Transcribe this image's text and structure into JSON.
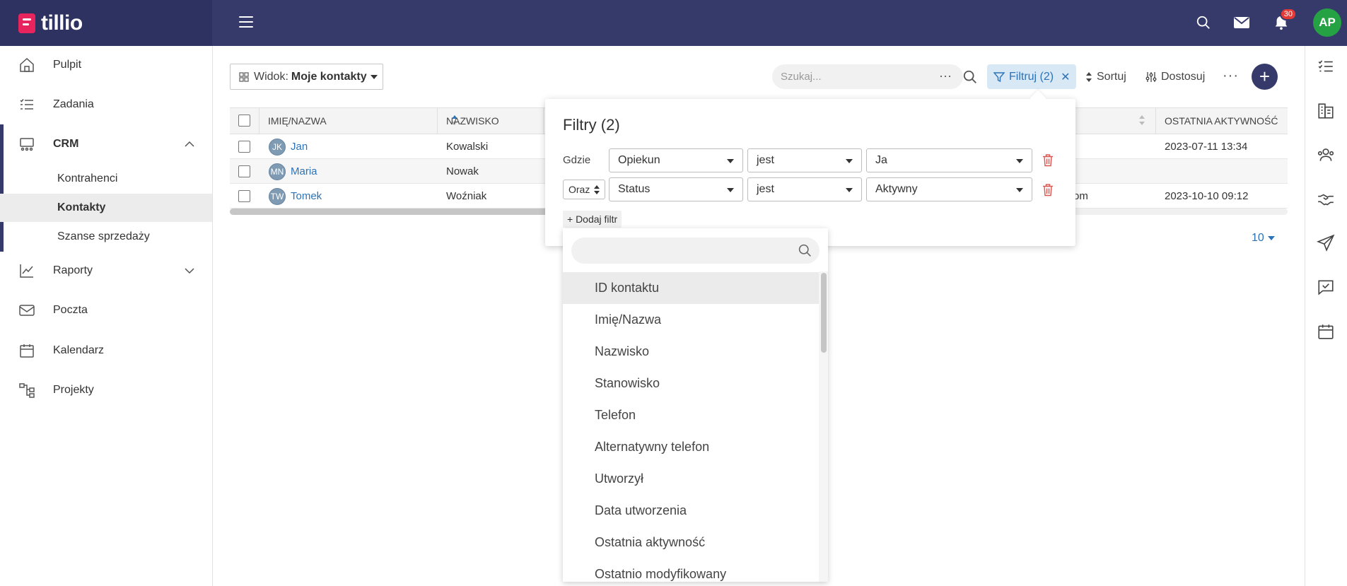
{
  "app": {
    "name": "tillio"
  },
  "topbar": {
    "notifications_count": "30",
    "user_initials": "AP"
  },
  "sidebar": {
    "items": [
      {
        "label": "Pulpit"
      },
      {
        "label": "Zadania"
      },
      {
        "label": "CRM"
      },
      {
        "label": "Raporty"
      },
      {
        "label": "Poczta"
      },
      {
        "label": "Kalendarz"
      },
      {
        "label": "Projekty"
      }
    ],
    "crm_sub": [
      {
        "label": "Kontrahenci"
      },
      {
        "label": "Kontakty"
      },
      {
        "label": "Szanse sprzedaży"
      }
    ]
  },
  "toolbar": {
    "view_prefix": "Widok:",
    "view_name": "Moje kontakty",
    "search_placeholder": "Szukaj...",
    "filter_label": "Filtruj (2)",
    "sort_label": "Sortuj",
    "customize_label": "Dostosuj"
  },
  "table": {
    "columns": [
      "IMIĘ/NAZWA",
      "NAZWISKO",
      "OSTATNIA AKTYWNOŚĆ"
    ],
    "rows": [
      {
        "initials": "JK",
        "first": "Jan",
        "last": "Kowalski",
        "email_tail": "",
        "activity": "2023-07-11 13:34"
      },
      {
        "initials": "MN",
        "first": "Maria",
        "last": "Nowak",
        "email_tail": "",
        "activity": ""
      },
      {
        "initials": "TW",
        "first": "Tomek",
        "last": "Woźniak",
        "email_tail": "om",
        "activity": "2023-10-10 09:12"
      }
    ],
    "page_size": "10"
  },
  "filters": {
    "title": "Filtry (2)",
    "where_label": "Gdzie",
    "and_label": "Oraz",
    "rows": [
      {
        "field": "Opiekun",
        "op": "jest",
        "value": "Ja"
      },
      {
        "field": "Status",
        "op": "jest",
        "value": "Aktywny"
      }
    ],
    "add_label": "+ Dodaj filtr"
  },
  "field_dropdown": {
    "options": [
      "ID kontaktu",
      "Imię/Nazwa",
      "Nazwisko",
      "Stanowisko",
      "Telefon",
      "Alternatywny telefon",
      "Utworzył",
      "Data utworzenia",
      "Ostatnia aktywność",
      "Ostatnio modyfikowany"
    ],
    "highlighted": "ID kontaktu"
  },
  "colors": {
    "primary": "#363a6b",
    "accent": "#2c73b8",
    "brand": "#e8245e",
    "danger": "#d9534f",
    "avatar": "#25a244"
  }
}
